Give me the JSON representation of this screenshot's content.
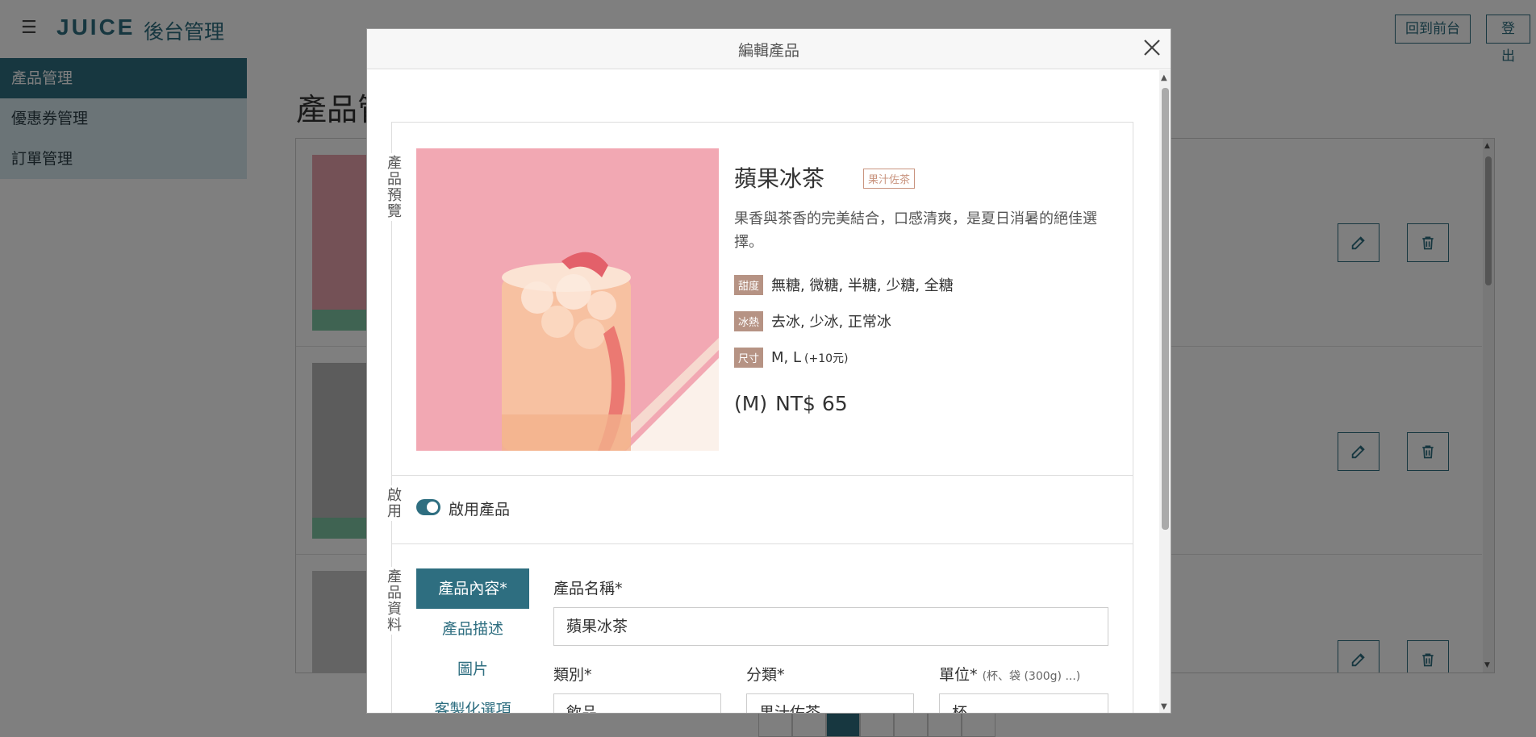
{
  "header": {
    "menu_icon": "☰",
    "logo": "JUICE",
    "admin_title": "後台管理",
    "front_label": "回到前台",
    "logout_label": "登出"
  },
  "sidebar": {
    "items": [
      {
        "label": "產品管理",
        "active": true
      },
      {
        "label": "優惠券管理",
        "active": false
      },
      {
        "label": "訂單管理",
        "active": false
      }
    ]
  },
  "main": {
    "page_title": "產品管理"
  },
  "modal": {
    "title": "編輯產品",
    "preview": {
      "section_label": "產品預覽",
      "name": "蘋果冰茶",
      "category_tag": "果汁佐茶",
      "description": "果香與茶香的完美結合，口感清爽，是夏日消暑的絕佳選擇。",
      "options": [
        {
          "badge": "甜度",
          "values": "無糖, 微糖, 半糖, 少糖, 全糖",
          "extra": ""
        },
        {
          "badge": "冰熱",
          "values": "去冰, 少冰, 正常冰",
          "extra": ""
        },
        {
          "badge": "尺寸",
          "values": "M, L",
          "extra": "(+10元)"
        }
      ],
      "price_size": "(M)",
      "price": "NT$ 65"
    },
    "enable": {
      "section_label": "啟用",
      "toggle_label": "啟用產品",
      "enabled": true
    },
    "data": {
      "section_label": "產品資料",
      "tabs": [
        "產品內容*",
        "產品描述",
        "圖片",
        "客製化選項"
      ],
      "name_label": "產品名稱*",
      "name_value": "蘋果冰茶",
      "type_label": "類別*",
      "type_value": "飲品",
      "category_label": "分類*",
      "category_value": "果汁佐茶",
      "unit_label": "單位*",
      "unit_hint": "(杯、袋 (300g) ...)",
      "unit_value": "杯"
    }
  },
  "colors": {
    "primary": "#2e6e80",
    "badge": "#b69384",
    "tag": "#c9947f",
    "sidebar_bg": "#d6e8ee"
  }
}
